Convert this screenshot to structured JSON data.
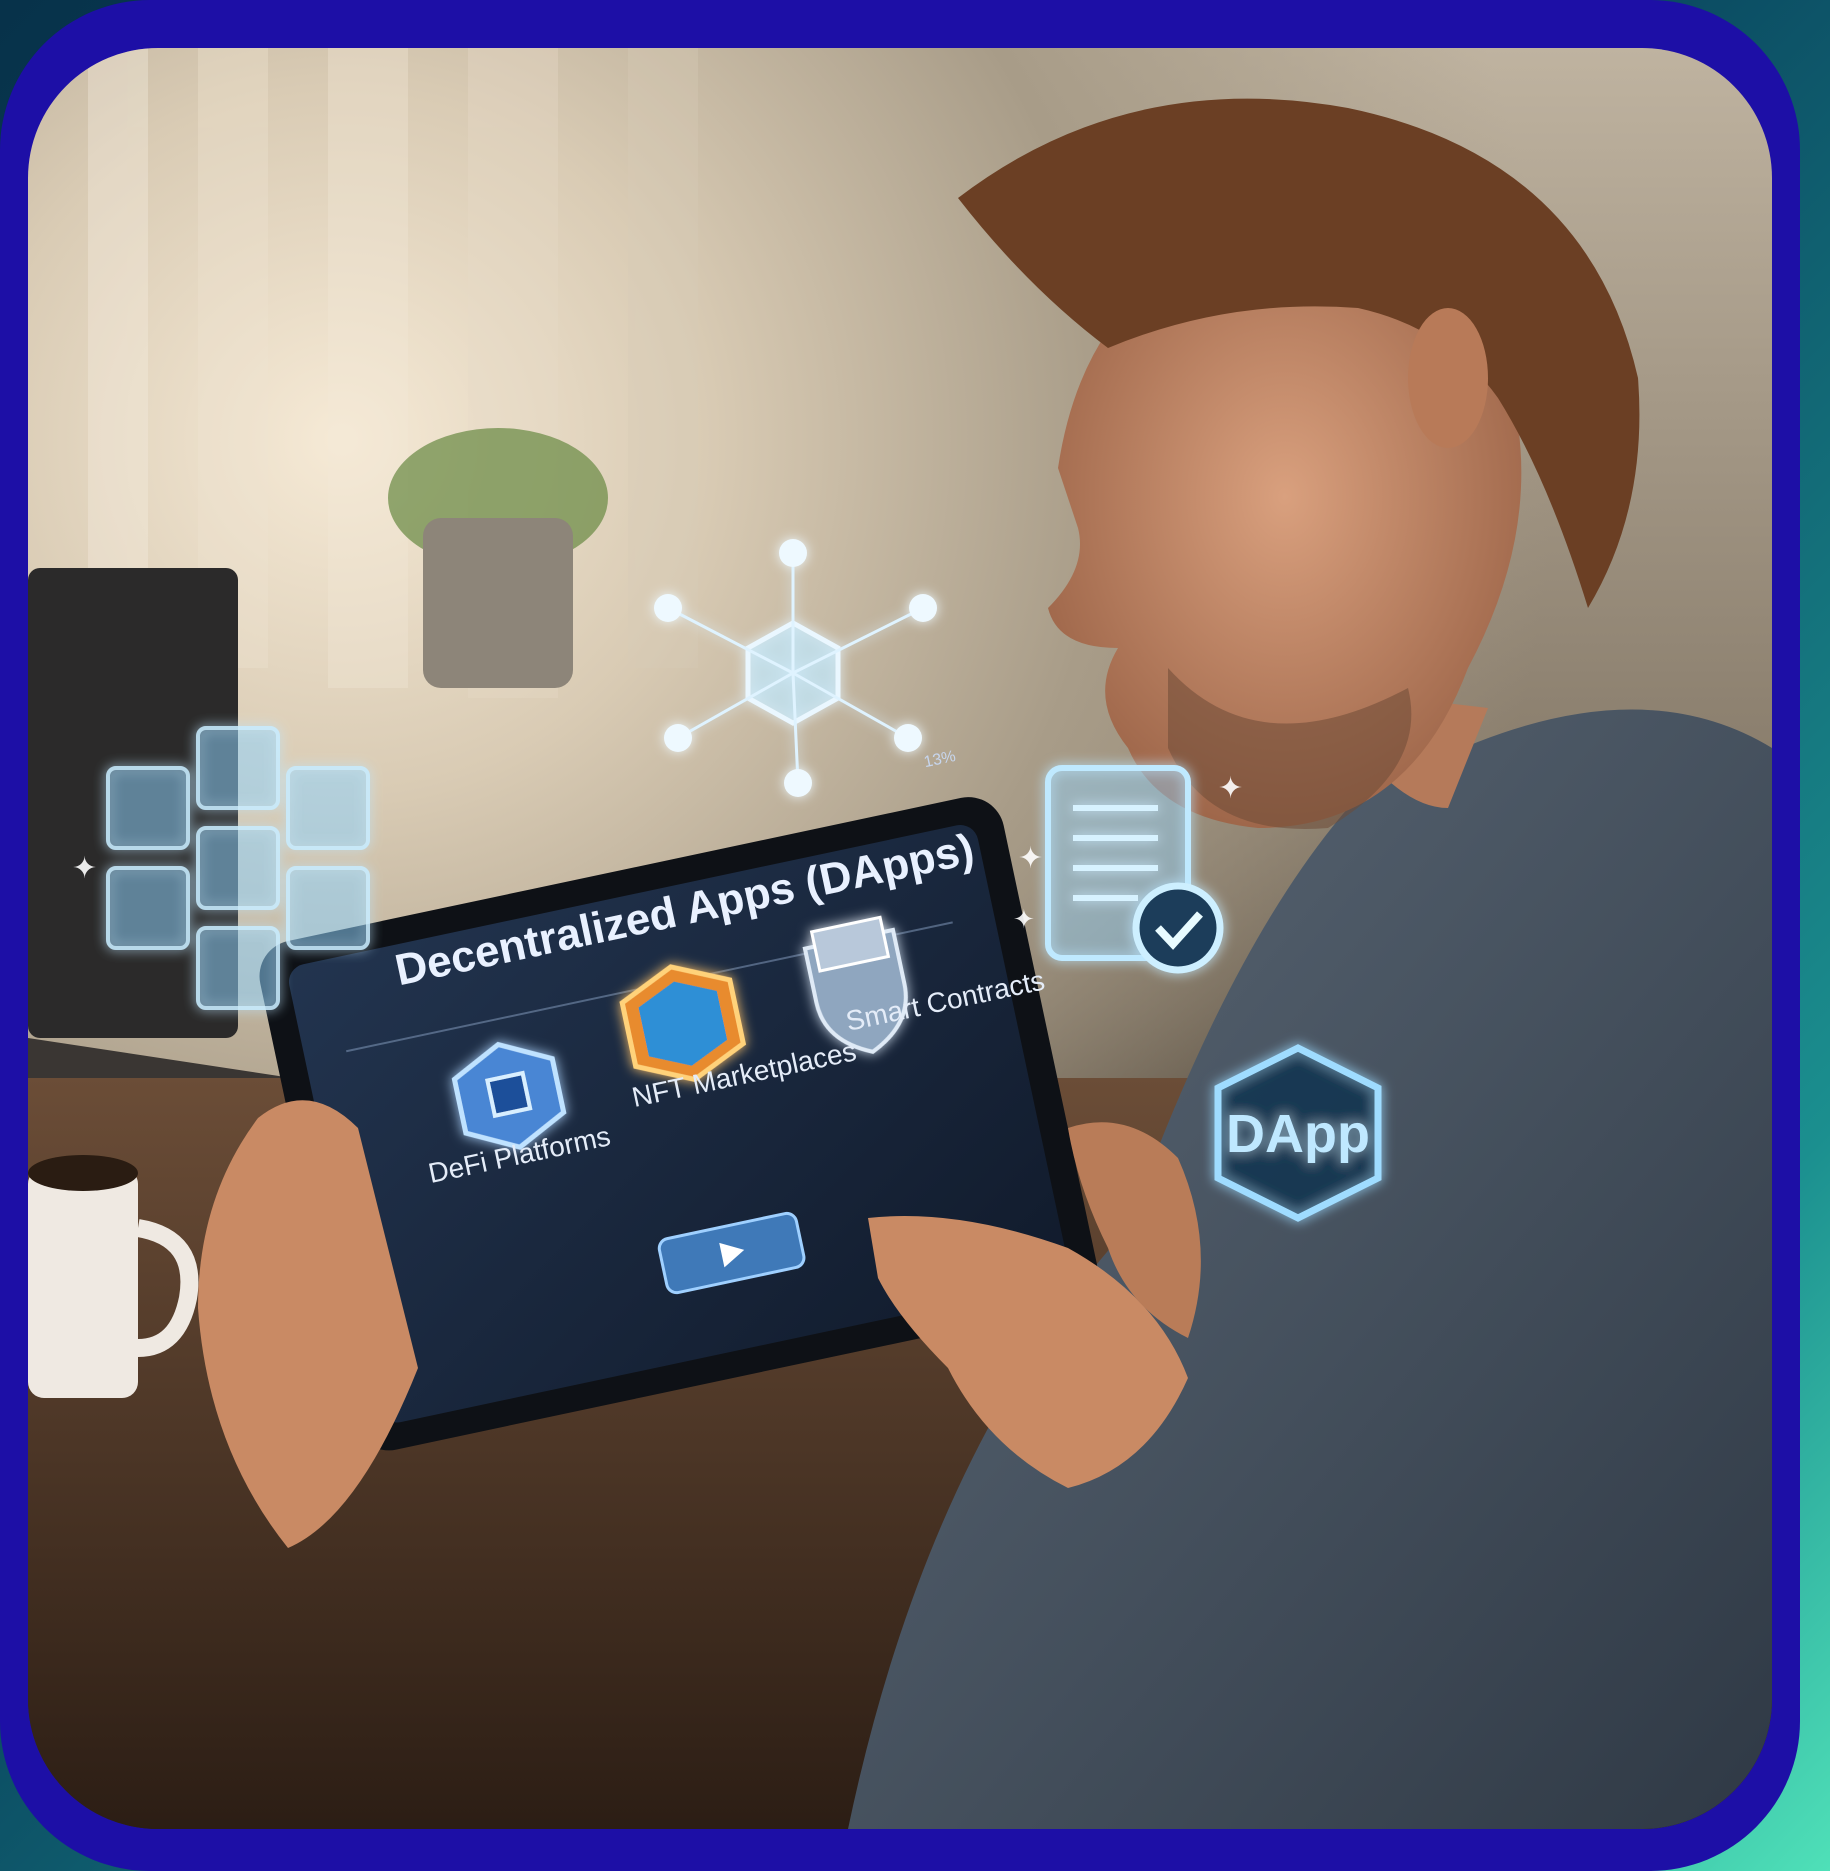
{
  "tablet": {
    "title": "Decentralized Apps (DApps)",
    "status": "13%",
    "items": [
      {
        "label": "DeFi Platforms",
        "icon": "defi-hexagon-icon"
      },
      {
        "label": "NFT Marketplaces",
        "icon": "nft-badge-icon"
      },
      {
        "label": "Smart Contracts",
        "icon": "smart-contract-shield-icon"
      }
    ],
    "action_icon": "play-icon"
  },
  "floating": {
    "dapp_badge": "DApp",
    "icons": [
      "blockchain-cubes-icon",
      "network-node-icon",
      "contract-check-icon",
      "dapp-hexagon-icon"
    ]
  },
  "colors": {
    "frame": "#1d0fa6",
    "glow": "#7fd3ff",
    "screen": "#1b2c47"
  }
}
